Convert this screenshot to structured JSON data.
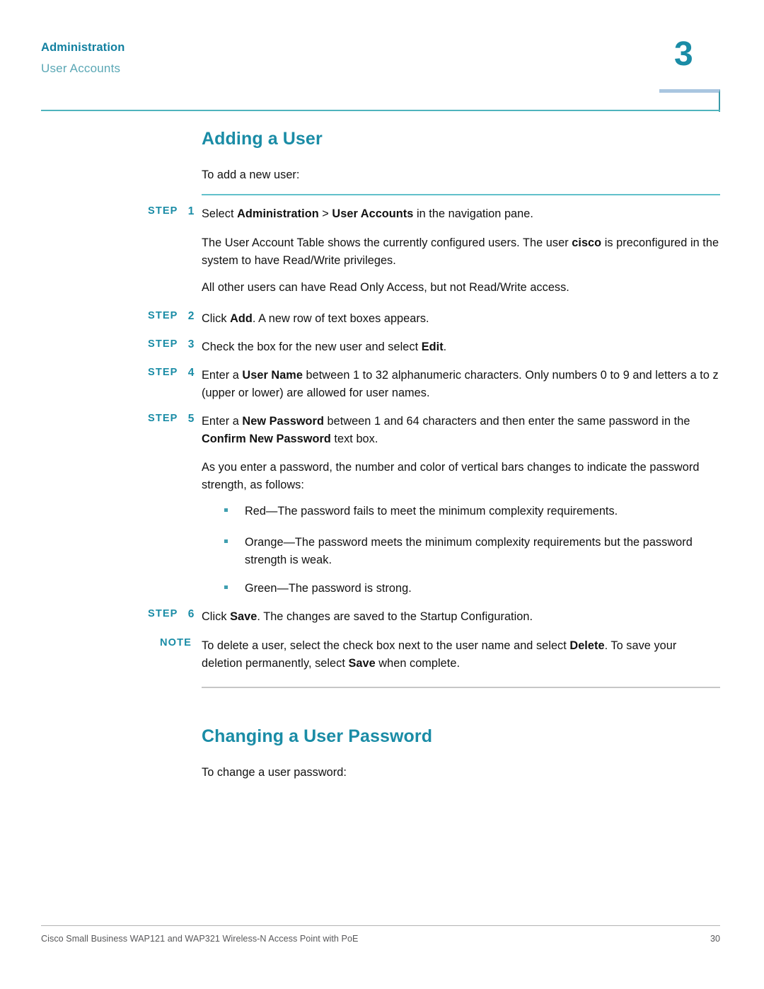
{
  "header": {
    "chapter_title": "Administration",
    "section_title": "User Accounts",
    "chapter_number": "3"
  },
  "colors": {
    "heading_teal": "#1a8ca6",
    "step_teal": "#1a8ca6",
    "rule_teal": "#62c0cb",
    "rule_gray": "#c6c6c6",
    "subtitle_teal": "#5aa7b5",
    "body_text": "#111111",
    "footer_text": "#58585a"
  },
  "sections": {
    "adding_a_user": {
      "title": "Adding a User",
      "intro": "To add a new user:",
      "steps": [
        {
          "label": "STEP",
          "number": "1",
          "parts": [
            {
              "text": "Select ",
              "bold": false
            },
            {
              "text": "Administration",
              "bold": true
            },
            {
              "text": " > ",
              "bold": false
            },
            {
              "text": "User Accounts",
              "bold": true
            },
            {
              "text": " in the navigation pane.",
              "bold": false
            }
          ]
        },
        {
          "label": "STEP",
          "number": "2",
          "parts": [
            {
              "text": "Click ",
              "bold": false
            },
            {
              "text": "Add",
              "bold": true
            },
            {
              "text": ". A new row of text boxes appears.",
              "bold": false
            }
          ]
        },
        {
          "label": "STEP",
          "number": "3",
          "parts": [
            {
              "text": "Check the box for the new user and select ",
              "bold": false
            },
            {
              "text": "Edit",
              "bold": true
            },
            {
              "text": ".",
              "bold": false
            }
          ]
        },
        {
          "label": "STEP",
          "number": "4",
          "parts": [
            {
              "text": "Enter a ",
              "bold": false
            },
            {
              "text": "User Name",
              "bold": true
            },
            {
              "text": " between 1 to 32 alphanumeric characters. Only numbers 0 to 9 and letters a to z (upper or lower) are allowed for user names.",
              "bold": false
            }
          ]
        },
        {
          "label": "STEP",
          "number": "5",
          "parts": [
            {
              "text": "Enter a ",
              "bold": false
            },
            {
              "text": "New Password",
              "bold": true
            },
            {
              "text": " between 1 and 64 characters and then enter the same password in the ",
              "bold": false
            },
            {
              "text": "Confirm New Password",
              "bold": true
            },
            {
              "text": " text box.",
              "bold": false
            }
          ]
        },
        {
          "label": "STEP",
          "number": "6",
          "parts": [
            {
              "text": "Click ",
              "bold": false
            },
            {
              "text": "Save",
              "bold": true
            },
            {
              "text": ". The changes are saved to the Startup Configuration.",
              "bold": false
            }
          ]
        }
      ],
      "paragraph_user_account_table": [
        {
          "text": "The User Account Table shows the currently configured users. The user ",
          "bold": false
        },
        {
          "text": "cisco",
          "bold": true
        },
        {
          "text": " is preconfigured in the system to have Read/Write privileges.",
          "bold": false
        }
      ],
      "paragraph_other_users": "All other users can have Read Only Access, but not Read/Write access.",
      "paragraph_password_bars": "As you enter a password, the number and color of vertical bars changes to indicate the password strength, as follows:",
      "password_strength_bullets": [
        "Red—The password fails to meet the minimum complexity requirements.",
        "Orange—The password meets the minimum complexity requirements but the password strength is weak.",
        "Green—The password is strong."
      ],
      "note": {
        "label": "NOTE",
        "parts": [
          {
            "text": "To delete a user, select the check box next to the user name and select ",
            "bold": false
          },
          {
            "text": "Delete",
            "bold": true
          },
          {
            "text": ". To save your deletion permanently, select ",
            "bold": false
          },
          {
            "text": "Save",
            "bold": true
          },
          {
            "text": " when complete.",
            "bold": false
          }
        ]
      }
    },
    "changing_a_user_password": {
      "title": "Changing a User Password",
      "intro": "To change a user password:"
    }
  },
  "footer": {
    "text": "Cisco Small Business WAP121 and WAP321 Wireless-N Access Point with PoE",
    "page_number": "30"
  }
}
